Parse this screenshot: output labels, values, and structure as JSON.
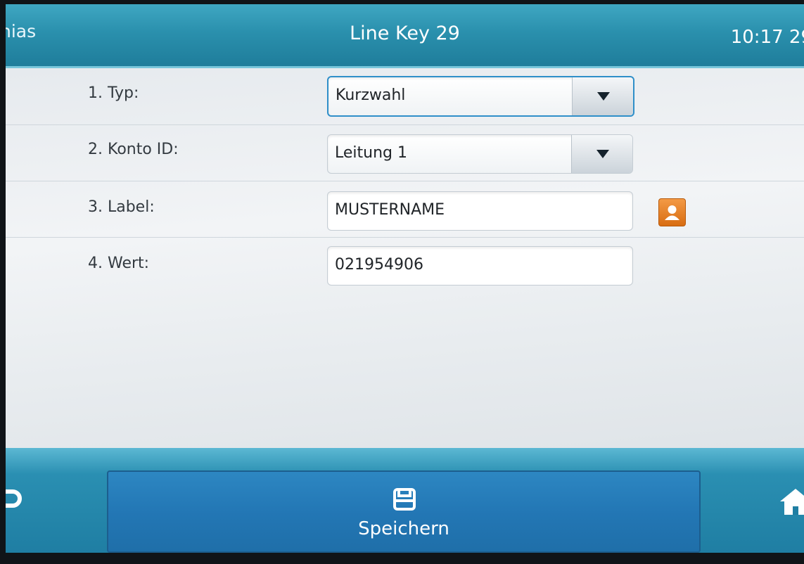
{
  "header": {
    "left_partial": "nias",
    "title": "Line Key 29",
    "time": "10:17 29"
  },
  "form": {
    "rows": [
      {
        "label": "1. Typ:",
        "value": "Kurzwahl",
        "control": "select",
        "focused": true
      },
      {
        "label": "2. Konto ID:",
        "value": "Leitung 1",
        "control": "select"
      },
      {
        "label": "3. Label:",
        "value": "MUSTERNAME",
        "control": "text",
        "side_icon": "contact-directory-icon"
      },
      {
        "label": "4. Wert:",
        "value": "021954906",
        "control": "text"
      }
    ]
  },
  "bottom": {
    "back_icon": "back-arrow-icon",
    "save_icon": "floppy-disk-icon",
    "save_label": "Speichern",
    "home_icon": "home-icon"
  },
  "colors": {
    "header": "#2a90ad",
    "bottom_bar": "#1f7ea3",
    "save_button": "#2377b5",
    "contact_button": "#e0781c",
    "focus_border": "#2f8fc9"
  }
}
